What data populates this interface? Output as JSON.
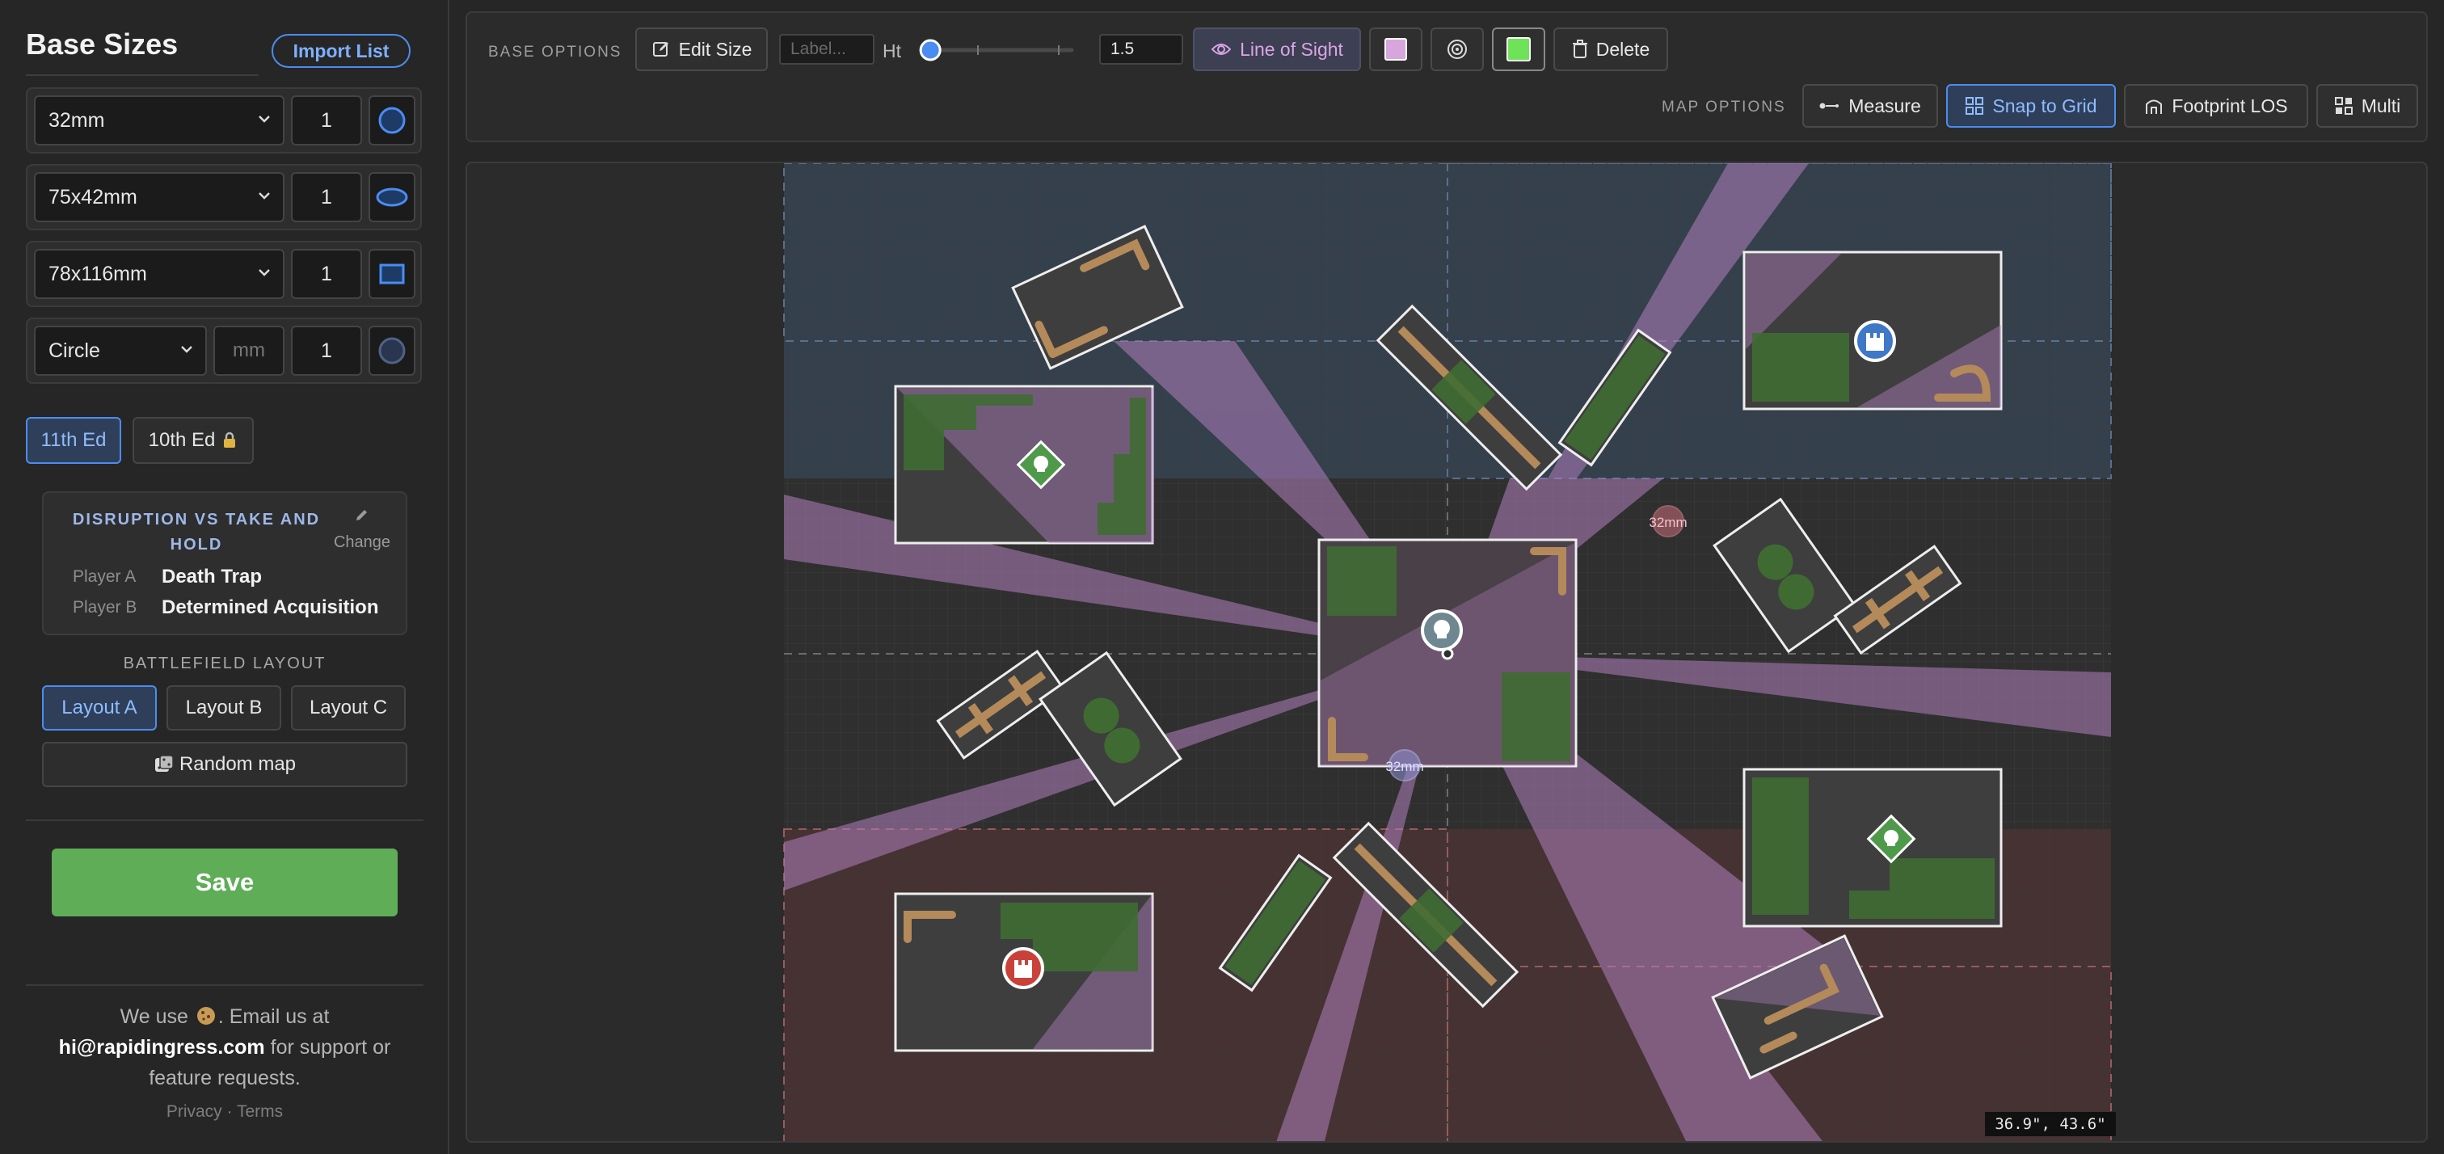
{
  "sidebar": {
    "title": "Base Sizes",
    "import_label": "Import List",
    "bases": [
      {
        "size": "32mm",
        "qty": "1",
        "shape_icon": "circle-shape-icon"
      },
      {
        "size": "75x42mm",
        "qty": "1",
        "shape_icon": "oval-shape-icon"
      },
      {
        "size": "78x116mm",
        "qty": "1",
        "shape_icon": "rect-shape-icon"
      },
      {
        "size": "Circle",
        "mm_placeholder": "mm",
        "qty": "1",
        "shape_icon": "circle-shape-icon"
      }
    ],
    "editions": {
      "active": "11th Ed",
      "other": "10th Ed",
      "other_icon": "lock-icon"
    },
    "mission": {
      "title": "DISRUPTION VS TAKE AND HOLD",
      "change_label": "Change",
      "player_a_label": "Player A",
      "player_a_value": "Death Trap",
      "player_b_label": "Player B",
      "player_b_value": "Determined Acquisition"
    },
    "battlefield_label": "BATTLEFIELD LAYOUT",
    "layouts": [
      "Layout A",
      "Layout B",
      "Layout C"
    ],
    "random_label": "Random map",
    "random_icon": "dice-icon",
    "save_label": "Save",
    "footer": {
      "line1_pre": "We use",
      "cookie_icon": "cookie-icon",
      "line1_post": ". Email us at",
      "email": "hi@rapidingress.com",
      "line2_post": " for support or feature requests.",
      "privacy": "Privacy",
      "dot": "·",
      "terms": "Terms"
    }
  },
  "toolbar": {
    "base_options_label": "BASE OPTIONS",
    "edit_size_label": "Edit Size",
    "label_placeholder": "Label...",
    "ht_label": "Ht",
    "height_value": "1.5",
    "height_slider_fraction": 0.06,
    "los_label": "Line of Sight",
    "delete_label": "Delete",
    "swatch_pink": "#d7a6dd",
    "swatch_green": "#6ee35a",
    "map_options_label": "MAP OPTIONS",
    "measure_label": "Measure",
    "snap_label": "Snap to Grid",
    "footprint_label": "Footprint LOS",
    "multi_label": "Multi"
  },
  "map": {
    "base_labels": [
      "32mm",
      "32mm"
    ],
    "coordinate_readout": "36.9\", 43.6\"",
    "colors": {
      "los": "#b07fbe",
      "terrain_green": "#3f6b33",
      "terrain_tan": "#b48a5a",
      "objective_green": "#4f9a4a",
      "objective_blue": "#3f78c7",
      "objective_red": "#c9423a",
      "objective_gray": "#6f8791",
      "deploy_blue": "#3b4e66",
      "deploy_red": "#5a3434"
    }
  }
}
